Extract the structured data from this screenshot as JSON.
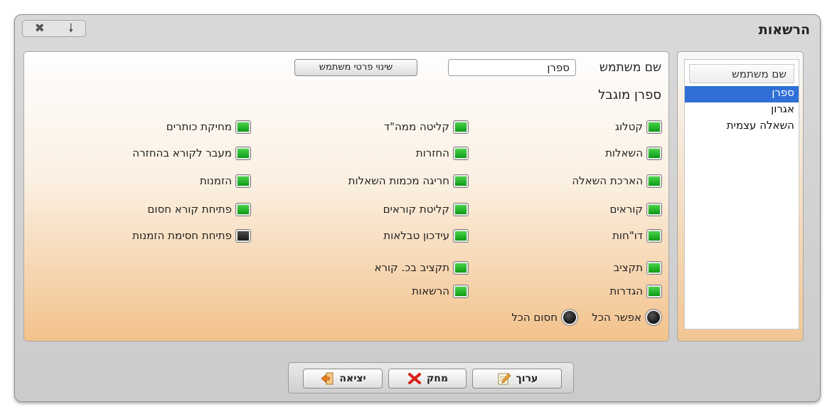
{
  "window": {
    "title": "הרשאות",
    "close_glyph": "✖",
    "pin_glyph": "🠗"
  },
  "user_list": {
    "header": "שם משתמש",
    "items": [
      "ספרן",
      "אגרון",
      "השאלה עצמית"
    ],
    "selected": "ספרן"
  },
  "details": {
    "username_label": "שם משתמש",
    "username_value": "ספרן",
    "change_button": "שינוי פרטי משתמש",
    "role_title": "ספרן מוגבל"
  },
  "permissions": {
    "col1": [
      {
        "label": "קטלוג",
        "enabled": true
      },
      {
        "label": "השאלות",
        "enabled": true
      },
      {
        "label": "הארכת השאלה",
        "enabled": true
      },
      {
        "label": "קוראים",
        "enabled": true
      },
      {
        "label": "דו\"חות",
        "enabled": true
      },
      {
        "label": "תקציב",
        "enabled": true
      },
      {
        "label": "הגדרות",
        "enabled": true
      }
    ],
    "col2": [
      {
        "label": "קליטה ממה\"ד",
        "enabled": true
      },
      {
        "label": "החזרות",
        "enabled": true
      },
      {
        "label": "חריגה מכמות השאלות",
        "enabled": true
      },
      {
        "label": "קליטת קוראים",
        "enabled": true
      },
      {
        "label": "עידכון טבלאות",
        "enabled": true
      },
      {
        "label": "תקציב בכ. קורא",
        "enabled": true
      },
      {
        "label": "הרשאות",
        "enabled": true
      }
    ],
    "col3": [
      {
        "label": "מחיקת כותרים",
        "enabled": true
      },
      {
        "label": "מעבר לקורא בהחזרה",
        "enabled": true
      },
      {
        "label": "הזמנות",
        "enabled": true
      },
      {
        "label": "פתיחת קורא חסום",
        "enabled": true
      },
      {
        "label": "פתיחת חסימת הזמנות",
        "enabled": false
      }
    ]
  },
  "bulk": {
    "enable_all": "אפשר הכל",
    "block_all": "חסום הכל"
  },
  "toolbar": {
    "edit": "ערוך",
    "delete": "מחק",
    "exit": "יציאה"
  },
  "colors": {
    "checked": "#16a321",
    "unchecked": "#222222",
    "selection": "#2f6fd6",
    "panel_gradient_end": "#f3c28c"
  }
}
